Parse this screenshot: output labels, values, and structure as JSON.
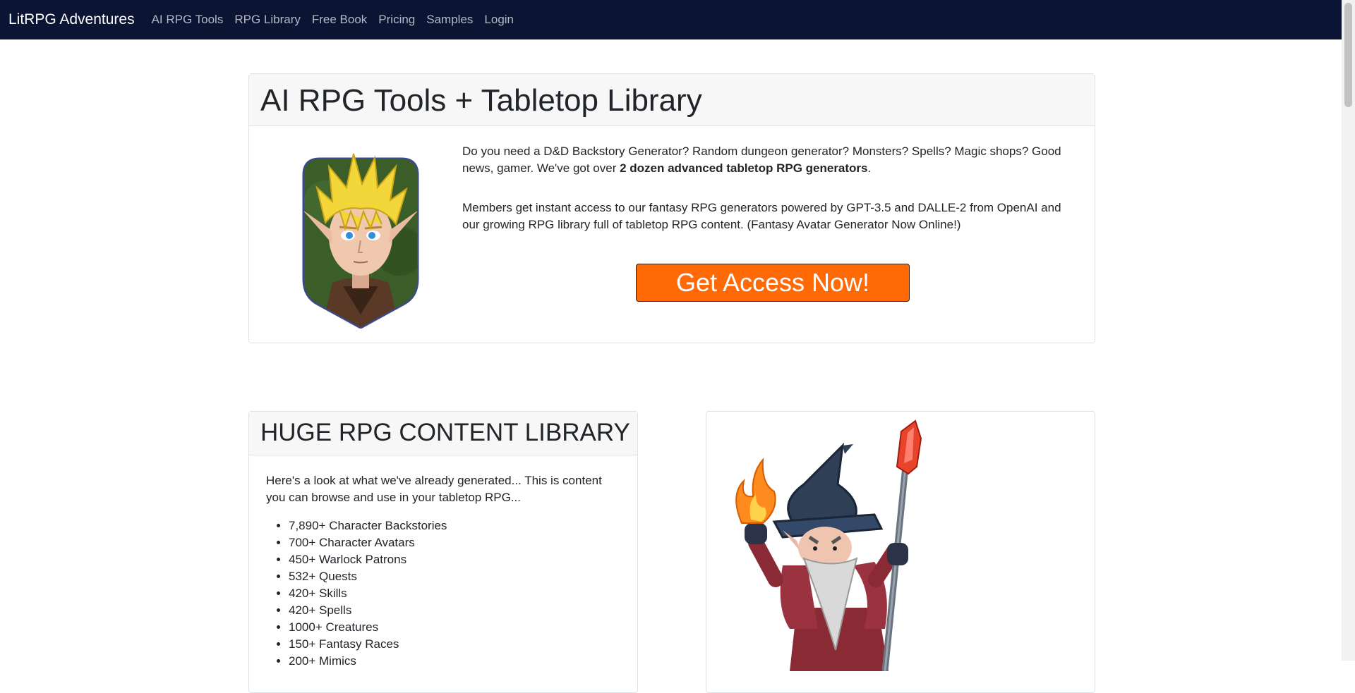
{
  "nav": {
    "brand": "LitRPG Adventures",
    "links": [
      "AI RPG Tools",
      "RPG Library",
      "Free Book",
      "Pricing",
      "Samples",
      "Login"
    ]
  },
  "hero": {
    "title": "AI RPG Tools + Tabletop Library",
    "p1_pre": "Do you need a D&D Backstory Generator? Random dungeon generator? Monsters? Spells? Magic shops? Good news, gamer. We've got over ",
    "p1_bold": "2 dozen advanced tabletop RPG generators",
    "p1_post": ".",
    "p2": "Members get instant access to our fantasy RPG generators powered by GPT-3.5 and DALLE-2 from OpenAI and our growing RPG library full of tabletop RPG content. (Fantasy Avatar Generator Now Online!)",
    "cta_label": "Get Access Now!"
  },
  "library": {
    "title": "HUGE RPG CONTENT LIBRARY",
    "intro": "Here's a look at what we've already generated... This is content you can browse and use in your tabletop RPG...",
    "items": [
      "7,890+ Character Backstories",
      "700+ Character Avatars",
      "450+ Warlock Patrons",
      "532+ Quests",
      "420+ Skills",
      "420+ Spells",
      "1000+ Creatures",
      "150+ Fantasy Races",
      "200+ Mimics"
    ]
  },
  "colors": {
    "navbar": "#0c1433",
    "cta": "#ff6a06"
  },
  "icons": {
    "hero_image": "elf-avatar-illustration",
    "side_image": "wizard-illustration"
  }
}
